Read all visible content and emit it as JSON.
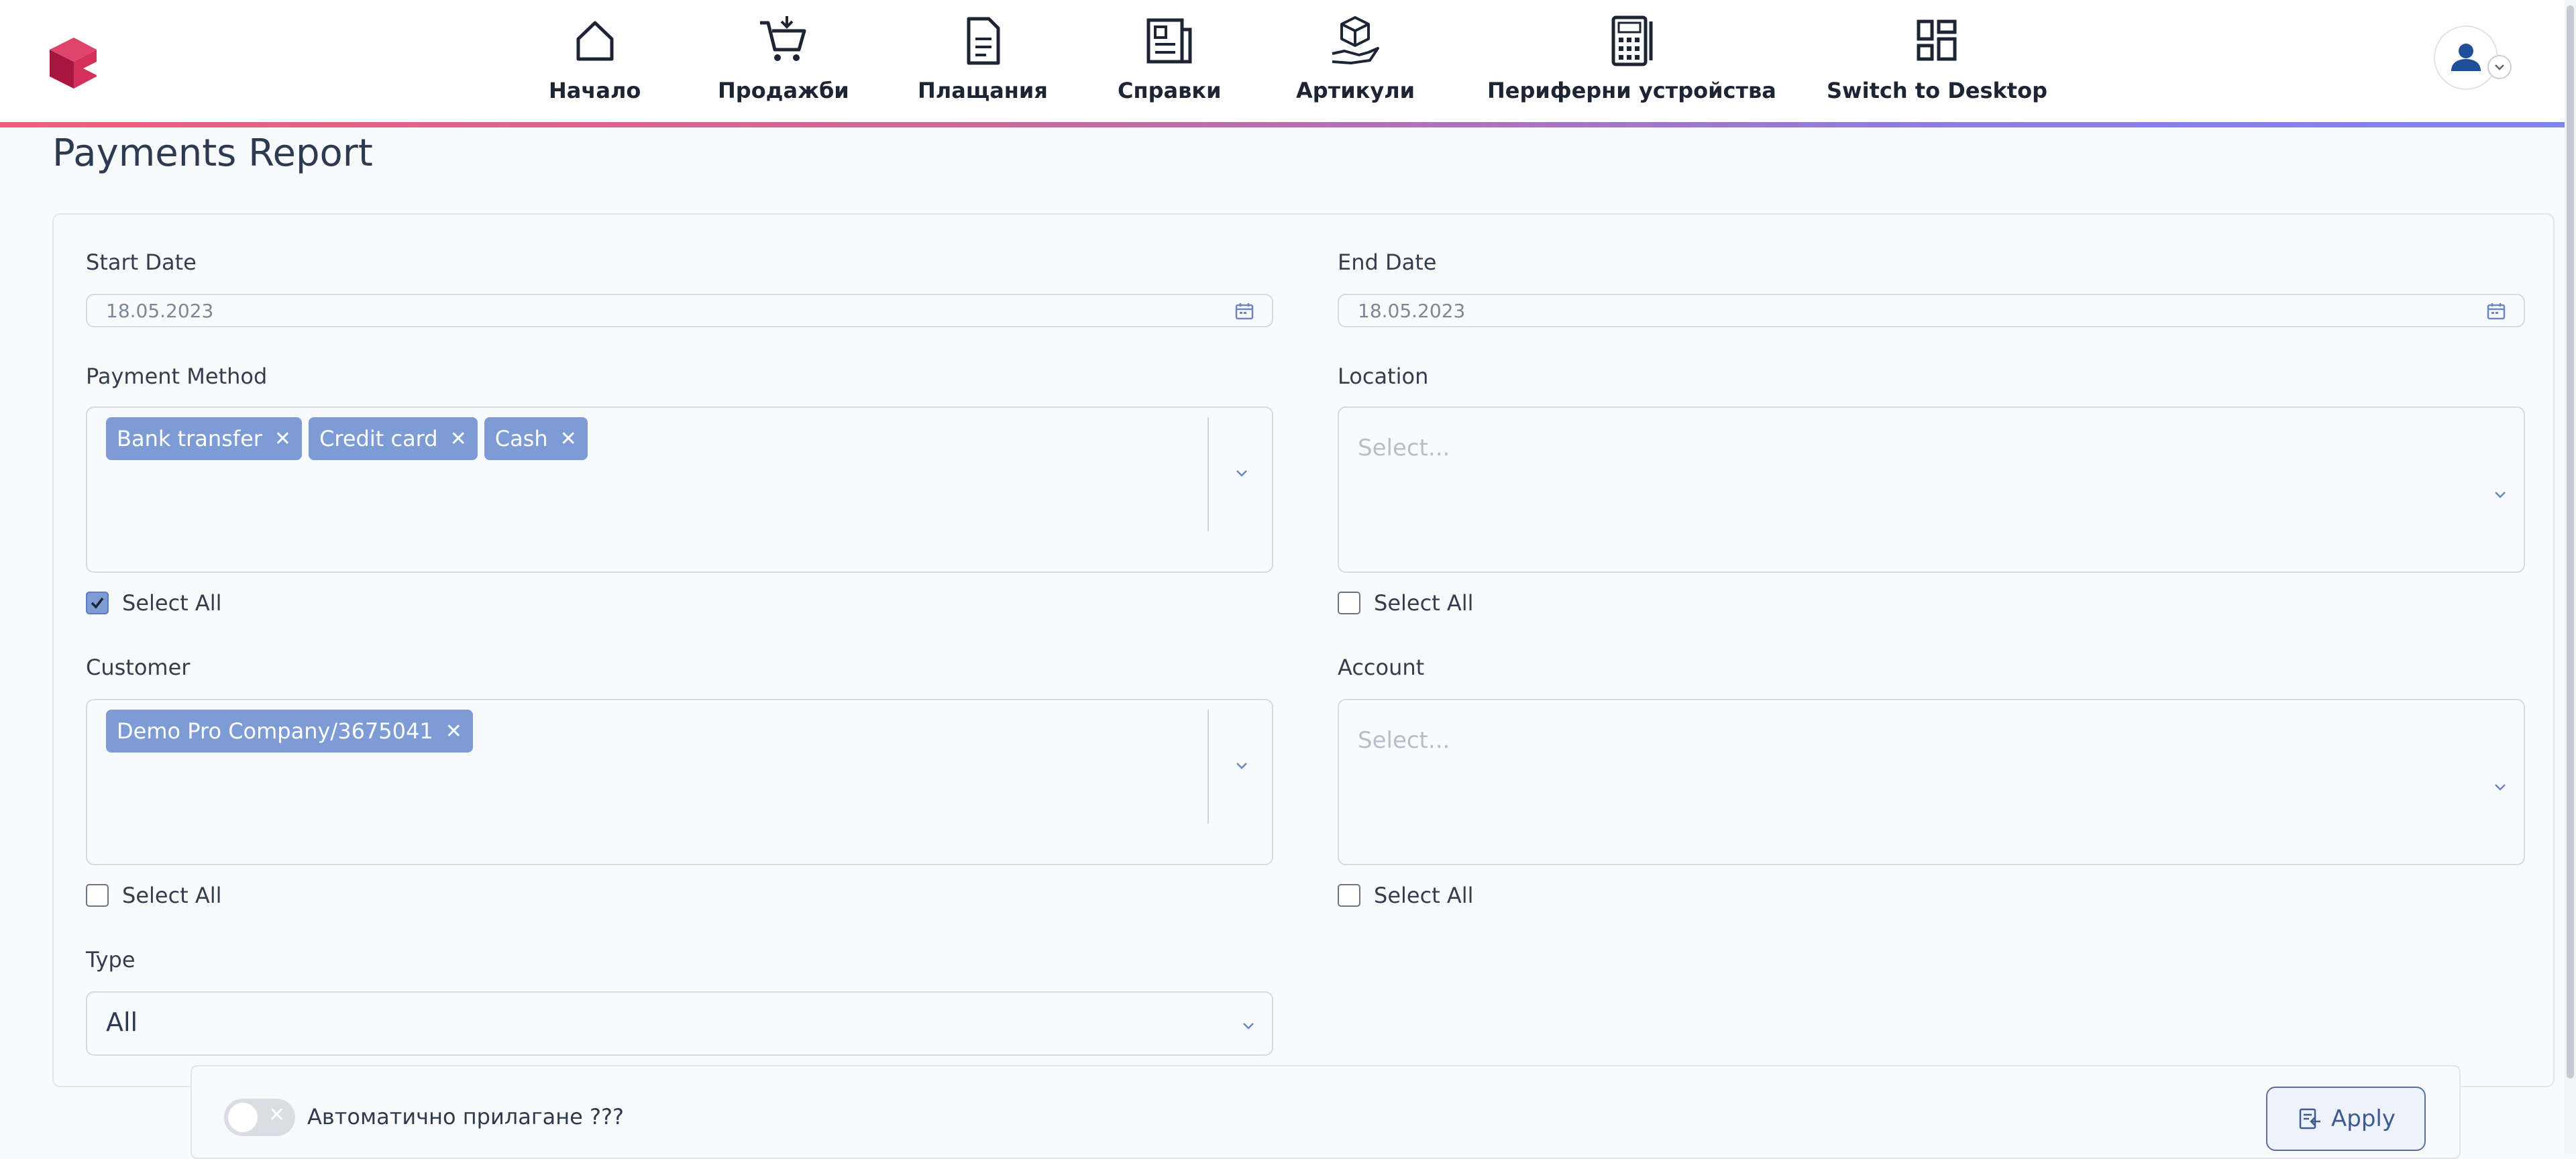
{
  "nav": {
    "items": [
      {
        "label": "Начало",
        "icon": "home-icon"
      },
      {
        "label": "Продажби",
        "icon": "cart-add-icon"
      },
      {
        "label": "Плащания",
        "icon": "document-icon"
      },
      {
        "label": "Справки",
        "icon": "newspaper-icon"
      },
      {
        "label": "Артикули",
        "icon": "box-hand-icon"
      },
      {
        "label": "Периферни устройства",
        "icon": "calculator-icon"
      },
      {
        "label": "Switch to Desktop",
        "icon": "dashboard-icon"
      }
    ],
    "gradient_colors": [
      "#e8617a",
      "#8f7be0"
    ]
  },
  "page": {
    "title": "Payments Report"
  },
  "filters": {
    "start_date": {
      "label": "Start Date",
      "value": "18.05.2023"
    },
    "end_date": {
      "label": "End Date",
      "value": "18.05.2023"
    },
    "payment_method": {
      "label": "Payment Method",
      "chips": [
        "Bank transfer",
        "Credit card",
        "Cash"
      ],
      "select_all_label": "Select All",
      "select_all_checked": true
    },
    "location": {
      "label": "Location",
      "placeholder": "Select...",
      "select_all_label": "Select All",
      "select_all_checked": false
    },
    "customer": {
      "label": "Customer",
      "chips": [
        "Demo Pro Company/3675041"
      ],
      "select_all_label": "Select All",
      "select_all_checked": false
    },
    "account": {
      "label": "Account",
      "placeholder": "Select...",
      "select_all_label": "Select All",
      "select_all_checked": false
    },
    "type": {
      "label": "Type",
      "value": "All"
    }
  },
  "actions": {
    "auto_apply_label": "Автоматично прилагане ???",
    "auto_apply_on": false,
    "apply_label": "Apply"
  },
  "colors": {
    "chip": "#7d9bd4",
    "accent": "#3f5a8e",
    "text": "#2c3b52"
  }
}
